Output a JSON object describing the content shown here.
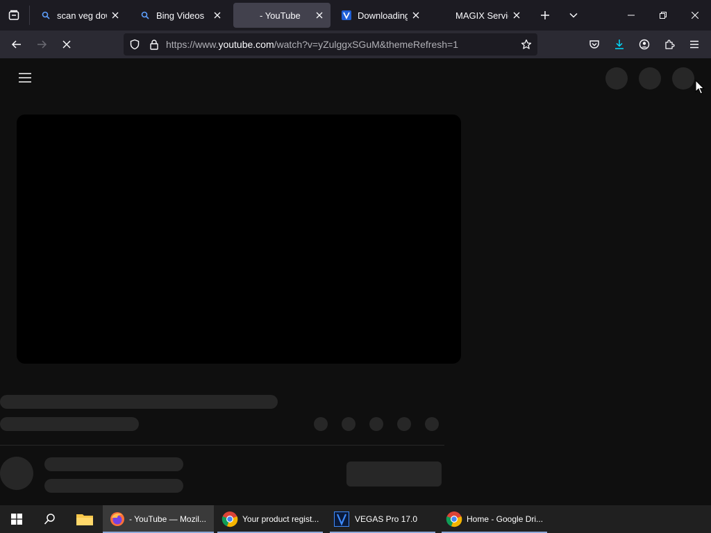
{
  "tabs": [
    {
      "title": "scan veg downlo",
      "icon": "search-icon",
      "active": false
    },
    {
      "title": "Bing Videos",
      "icon": "search-icon",
      "active": false
    },
    {
      "title": "- YouTube",
      "icon": "",
      "active": true
    },
    {
      "title": "Downloading VE",
      "icon": "vegas-icon",
      "active": false
    },
    {
      "title": "MAGIX Service Cente",
      "icon": "",
      "active": false
    }
  ],
  "url": {
    "prefix": "https://www.",
    "host": "youtube.com",
    "path": "/watch?v=yZulggxSGuM&themeRefresh=1"
  },
  "taskbar": {
    "items": [
      {
        "label": "- YouTube — Mozil...",
        "icon": "firefox-icon",
        "active": true
      },
      {
        "label": "Your product regist...",
        "icon": "chrome-icon",
        "active": false
      },
      {
        "label": "VEGAS Pro 17.0",
        "icon": "vegas-icon",
        "active": false
      },
      {
        "label": "Home - Google Dri...",
        "icon": "chrome-icon",
        "active": false
      }
    ]
  },
  "colors": {
    "tabbar": "#1c1b22",
    "navbar": "#2b2a33",
    "page_background": "#0f0f0f",
    "skeleton": "#272727",
    "download_accent": "#00ddff"
  }
}
